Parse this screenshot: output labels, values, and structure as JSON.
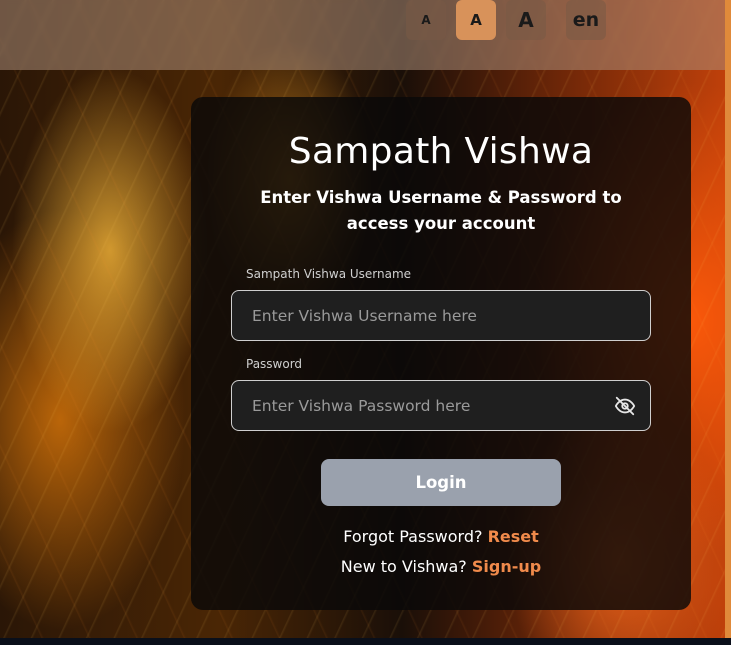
{
  "header": {
    "font_small_label": "A",
    "font_medium_label": "A",
    "font_large_label": "A",
    "language_label": "en"
  },
  "login": {
    "title": "Sampath Vishwa",
    "subtitle": "Enter Vishwa Username & Password to access your account",
    "username_label": "Sampath Vishwa Username",
    "username_placeholder": "Enter Vishwa Username here",
    "username_value": "",
    "password_label": "Password",
    "password_placeholder": "Enter Vishwa Password here",
    "password_value": "",
    "password_toggle_icon": "eye-off-icon",
    "login_label": "Login",
    "forgot_text": "Forgot Password?",
    "reset_link": "Reset",
    "new_text": "New to Vishwa?",
    "signup_link": "Sign-up"
  },
  "colors": {
    "accent": "#f08a4b",
    "button_disabled": "#9aa1ad",
    "active_font_button": "#d8925a"
  }
}
